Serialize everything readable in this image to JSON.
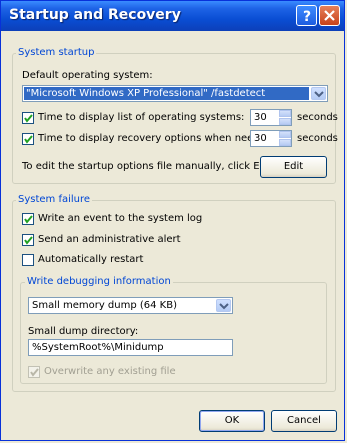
{
  "window": {
    "title": "Startup and Recovery"
  },
  "system_startup": {
    "group_label": "System startup",
    "default_os_label": "Default operating system:",
    "default_os_value": "\"Microsoft Windows XP Professional\" /fastdetect",
    "display_os_list": {
      "label": "Time to display list of operating systems:",
      "checked": true,
      "value": "30",
      "unit": "seconds"
    },
    "display_recovery": {
      "label": "Time to display recovery options when needed:",
      "checked": true,
      "value": "30",
      "unit": "seconds"
    },
    "edit_hint": "To edit the startup options file manually, click Edit.",
    "edit_button": "Edit"
  },
  "system_failure": {
    "group_label": "System failure",
    "write_event": {
      "label": "Write an event to the system log",
      "checked": true
    },
    "send_alert": {
      "label": "Send an administrative alert",
      "checked": true
    },
    "auto_restart": {
      "label": "Automatically restart",
      "checked": false
    },
    "debug_group_label": "Write debugging information",
    "dump_type": "Small memory dump (64 KB)",
    "dump_dir_label": "Small dump directory:",
    "dump_dir_value": "%SystemRoot%\\Minidump",
    "overwrite": {
      "label": "Overwrite any existing file",
      "checked": true,
      "enabled": false
    }
  },
  "buttons": {
    "ok": "OK",
    "cancel": "Cancel"
  }
}
